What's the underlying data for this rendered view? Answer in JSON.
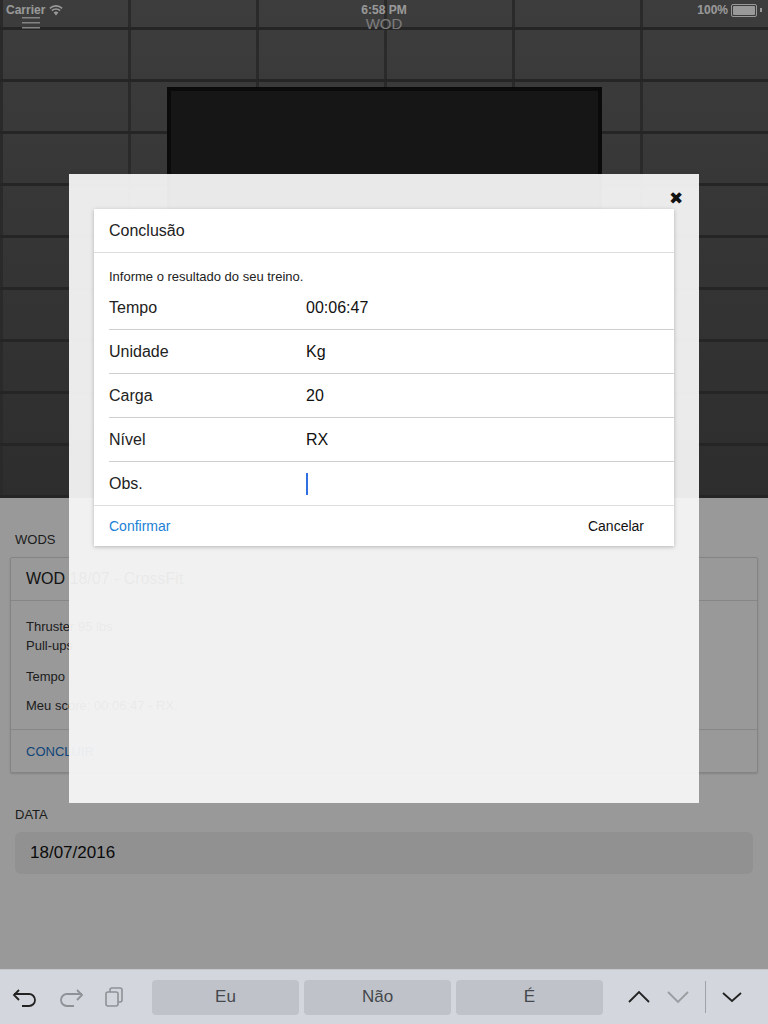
{
  "status_bar": {
    "carrier": "Carrier",
    "time": "6:58 PM",
    "battery": "100%",
    "battery_level": 1
  },
  "nav": {
    "title": "WOD"
  },
  "page": {
    "section_label": "WODS",
    "wod": {
      "title": "WOD 18/07 - CrossFit",
      "lines": [
        "Thruster 95 lbs",
        "Pull-ups"
      ],
      "type": "Tempo",
      "score": "Meu score: 00:06:47 - RX.",
      "action": "CONCLUIR"
    },
    "date_label": "DATA",
    "date_value": "18/07/2016"
  },
  "dialog": {
    "close": "✖",
    "title": "Conclusão",
    "hint": "Informe o resultado do seu treino.",
    "fields": [
      {
        "label": "Tempo",
        "value": "00:06:47",
        "focused": false
      },
      {
        "label": "Unidade",
        "value": "Kg",
        "focused": false
      },
      {
        "label": "Carga",
        "value": "20",
        "focused": false
      },
      {
        "label": "Nível",
        "value": "RX",
        "focused": false
      },
      {
        "label": "Obs.",
        "value": "",
        "focused": true
      }
    ],
    "buttons": [
      {
        "label": "Confirmar",
        "primary": true
      },
      {
        "label": "Cancelar",
        "primary": false
      }
    ]
  },
  "keyboard": {
    "suggestions": [
      "Eu",
      "Não",
      "É"
    ]
  }
}
